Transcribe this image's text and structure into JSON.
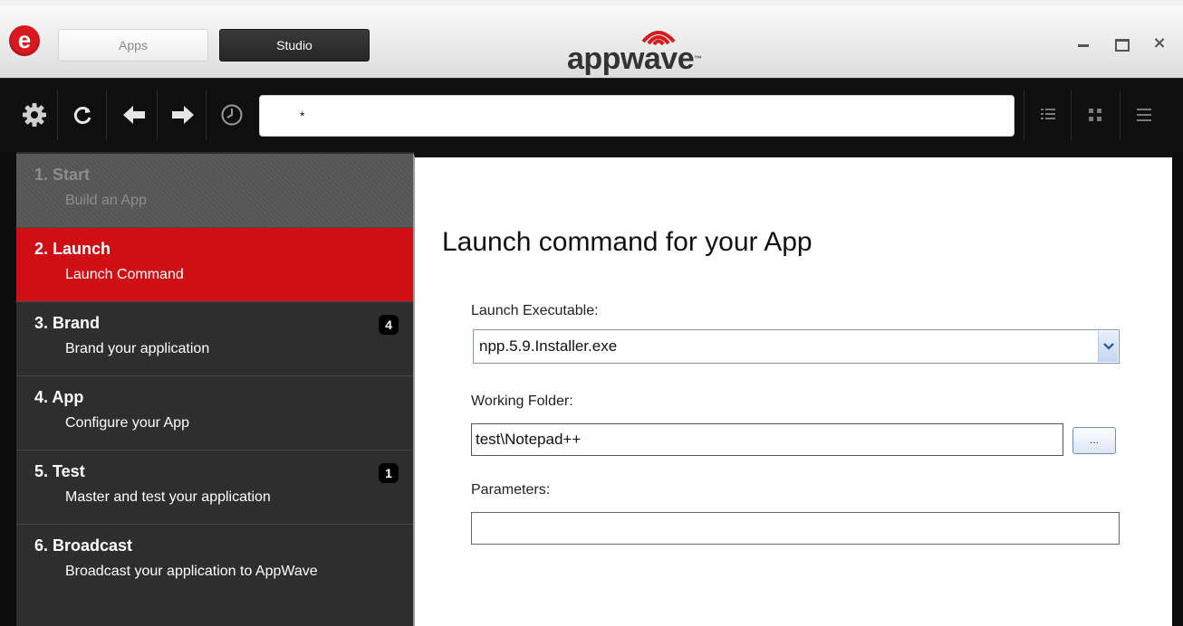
{
  "window": {
    "logo_letter": "e",
    "tabs": [
      {
        "label": "Apps",
        "active": false
      },
      {
        "label": "Studio",
        "active": true
      }
    ],
    "brand": "appwave",
    "brand_mark": "™",
    "controls": {
      "minimize": "minimize-icon",
      "maximize": "maximize-icon",
      "close": "×"
    }
  },
  "toolbar": {
    "icons": [
      "gear-icon",
      "refresh-icon",
      "back-arrow-icon",
      "forward-arrow-icon",
      "history-clock-icon"
    ],
    "search_value": "*",
    "view_icons": [
      "list-view-icon",
      "grid-view-icon",
      "menu-icon"
    ]
  },
  "sidebar": {
    "steps": [
      {
        "title": "1. Start",
        "subtitle": "Build an App",
        "state": "done"
      },
      {
        "title": "2. Launch",
        "subtitle": "Launch Command",
        "state": "active"
      },
      {
        "title": "3. Brand",
        "subtitle": "Brand your application",
        "count": "4"
      },
      {
        "title": "4. App",
        "subtitle": "Configure your App"
      },
      {
        "title": "5. Test",
        "subtitle": "Master and test your application",
        "count": "1"
      },
      {
        "title": "6. Broadcast",
        "subtitle": "Broadcast your application to AppWave"
      }
    ]
  },
  "main": {
    "heading": "Launch command for your App",
    "launch_executable": {
      "label": "Launch Executable:",
      "value": "npp.5.9.Installer.exe"
    },
    "working_folder": {
      "label": "Working Folder:",
      "value": "test\\Notepad++",
      "browse_label": "..."
    },
    "parameters": {
      "label": "Parameters:",
      "value": ""
    }
  },
  "colors": {
    "accent_red": "#d00f14",
    "sidebar_bg": "#2e2e2e",
    "toolbar_bg": "#0f0f0f",
    "studio_tab_bg": "#2b2b2b"
  }
}
